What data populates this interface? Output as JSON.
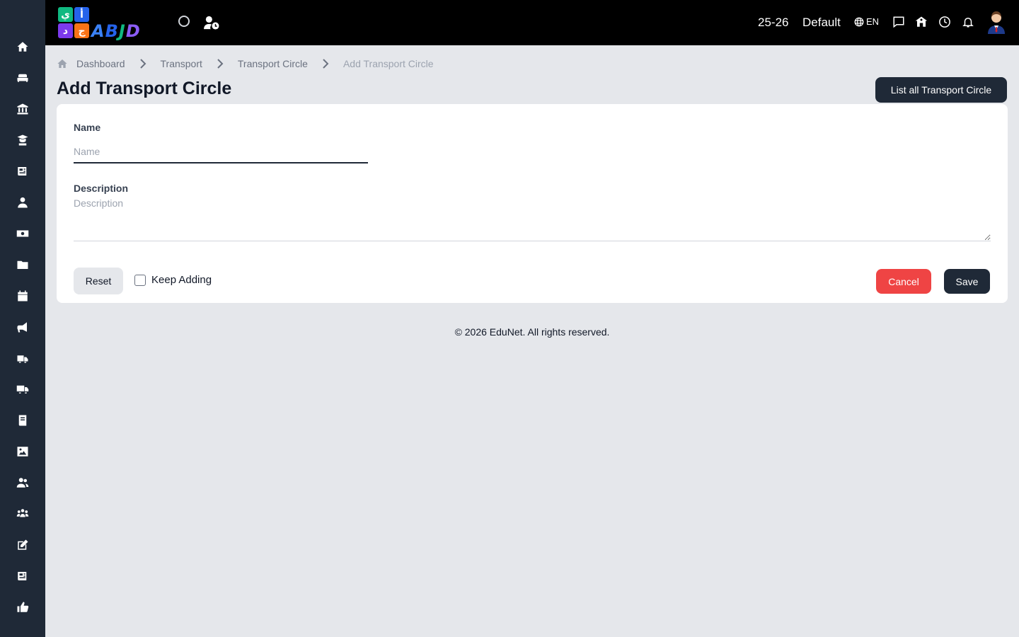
{
  "topbar": {
    "logo_text": "ABJD",
    "logo_tiles": [
      "ي",
      "أ",
      "د",
      "ج"
    ],
    "session": "25-26",
    "profile": "Default",
    "language": "EN"
  },
  "sidebar": {
    "icons": [
      "home-icon",
      "couch-icon",
      "bank-icon",
      "graduate-icon",
      "newspaper-icon",
      "user-tie-icon",
      "money-icon",
      "folder-icon",
      "calendar-icon",
      "megaphone-icon",
      "school-bus-icon",
      "truck-icon",
      "book-icon",
      "image-icon",
      "users-icon",
      "group-icon",
      "edit-icon",
      "news-icon",
      "thumbs-up-icon"
    ]
  },
  "breadcrumb": {
    "items": [
      "Dashboard",
      "Transport",
      "Transport Circle",
      "Add Transport Circle"
    ]
  },
  "page": {
    "title": "Add Transport Circle",
    "list_button": "List all Transport Circle"
  },
  "form": {
    "name_label": "Name",
    "name_placeholder": "Name",
    "name_value": "",
    "description_label": "Description",
    "description_placeholder": "Description",
    "description_value": "",
    "reset_label": "Reset",
    "keep_adding_label": "Keep Adding",
    "keep_adding_checked": false,
    "cancel_label": "Cancel",
    "save_label": "Save"
  },
  "footer": {
    "text": "© 2026 EduNet. All rights reserved."
  },
  "colors": {
    "sidebar": "#1f2937",
    "topbar": "#000000",
    "background": "#e5e7eb",
    "primary_button": "#1f2937",
    "danger_button": "#ef4444"
  }
}
